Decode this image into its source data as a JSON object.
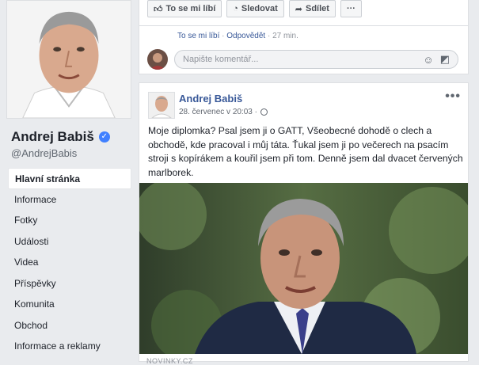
{
  "sidebar": {
    "page_name": "Andrej Babiš",
    "handle": "@AndrejBabis",
    "verified_icon": "verified-badge-icon",
    "items": [
      {
        "label": "Hlavní stránka",
        "active": true
      },
      {
        "label": "Informace"
      },
      {
        "label": "Fotky"
      },
      {
        "label": "Události"
      },
      {
        "label": "Videa"
      },
      {
        "label": "Příspěvky"
      },
      {
        "label": "Komunita"
      },
      {
        "label": "Obchod"
      },
      {
        "label": "Informace a reklamy"
      }
    ]
  },
  "actions": {
    "like": "To se mi líbí",
    "follow": "Sledovat",
    "share": "Sdílet",
    "more": "···"
  },
  "comment_meta": {
    "like": "To se mi líbí",
    "sep": " · ",
    "reply": "Odpovědět",
    "time": "27 min."
  },
  "comment_input": {
    "placeholder": "Napište komentář..."
  },
  "post": {
    "author": "Andrej Babiš",
    "time": "28. červenec v 20:03 ·",
    "menu": "•••",
    "text": "Moje diplomka? Psal jsem ji o GATT, Všeobecné dohodě o clech a obchodě, kde pracoval i můj táta. Ťukal jsem ji po večerech na psacím stroji s kopírákem a kouřil jsem při tom. Denně jsem dal dvacet červených marlborek.",
    "footer": "NOVINKY.CZ"
  },
  "colors": {
    "accent": "#385898",
    "background": "#e9ebee",
    "verified": "#4080ff"
  }
}
